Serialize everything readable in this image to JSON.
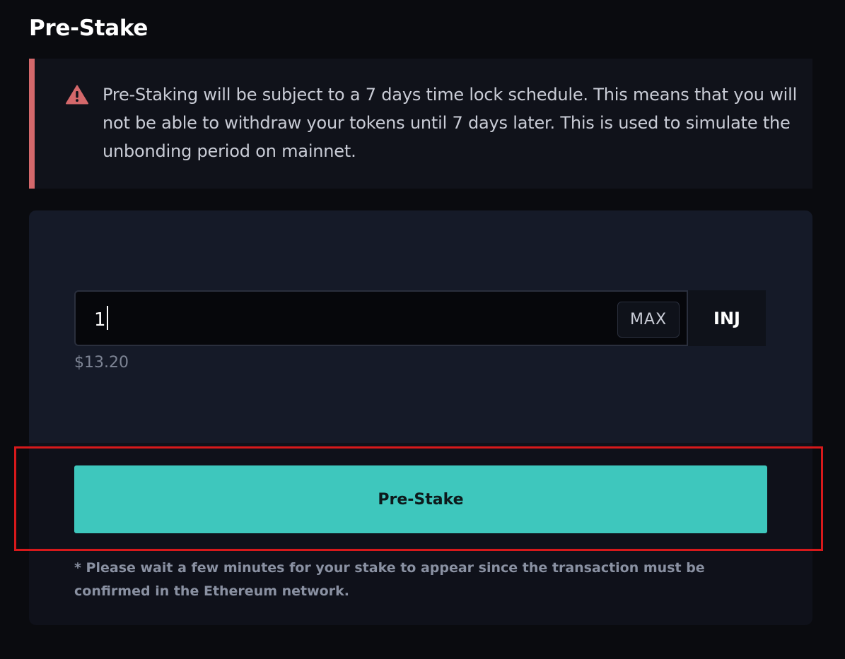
{
  "page": {
    "title": "Pre-Stake"
  },
  "warning": {
    "icon": "warning-triangle-icon",
    "color": "#d4686b",
    "text": "Pre-Staking will be subject to a 7 days time lock schedule. This means that you will not be able to withdraw your tokens until 7 days later. This is used to simulate the unbonding period on mainnet."
  },
  "stake_form": {
    "amount_value": "1",
    "max_label": "MAX",
    "token_symbol": "INJ",
    "usd_value": "$13.20",
    "submit_label": "Pre-Stake",
    "submit_color": "#3ec7bd",
    "note": "* Please wait a few minutes for your stake to appear since the transaction must be confirmed in the Ethereum network."
  }
}
